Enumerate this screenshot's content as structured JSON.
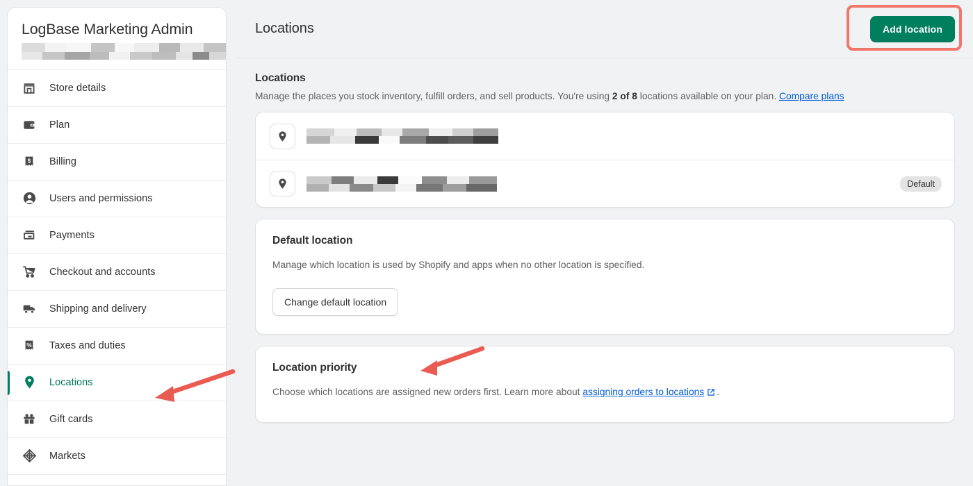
{
  "sidebar": {
    "store_title": "LogBase Marketing Admin",
    "store_subtitle_redacted": true,
    "items": [
      {
        "label": "Store details",
        "icon": "store-icon",
        "active": false
      },
      {
        "label": "Plan",
        "icon": "wallet-icon",
        "active": false
      },
      {
        "label": "Billing",
        "icon": "billing-receipt-icon",
        "active": false
      },
      {
        "label": "Users and permissions",
        "icon": "user-icon",
        "active": false
      },
      {
        "label": "Payments",
        "icon": "payments-card-icon",
        "active": false
      },
      {
        "label": "Checkout and accounts",
        "icon": "shopping-cart-icon",
        "active": false
      },
      {
        "label": "Shipping and delivery",
        "icon": "delivery-truck-icon",
        "active": false
      },
      {
        "label": "Taxes and duties",
        "icon": "percent-receipt-icon",
        "active": false
      },
      {
        "label": "Locations",
        "icon": "map-pin-icon",
        "active": true
      },
      {
        "label": "Gift cards",
        "icon": "gift-box-icon",
        "active": false
      },
      {
        "label": "Markets",
        "icon": "globe-icon",
        "active": false
      }
    ]
  },
  "header": {
    "title": "Locations",
    "add_location_label": "Add location"
  },
  "locations_section": {
    "title": "Locations",
    "description_part1": "Manage the places you stock inventory, fulfill orders, and sell products. You're using ",
    "description_count": "2 of 8",
    "description_part2": " locations available on your plan. ",
    "compare_plans_link": "Compare plans",
    "rows": [
      {
        "name_redacted": true,
        "badge": ""
      },
      {
        "name_redacted": true,
        "badge": "Default"
      }
    ]
  },
  "default_location_section": {
    "title": "Default location",
    "description": "Manage which location is used by Shopify and apps when no other location is specified.",
    "change_button_label": "Change default location"
  },
  "location_priority_section": {
    "title": "Location priority",
    "description_part1": "Choose which locations are assigned new orders first. Learn more about ",
    "link_label": "assigning orders to locations",
    "description_part2": "."
  },
  "colors": {
    "brand_green": "#007f5f",
    "annotation_red": "#f2776b",
    "link_blue": "#005bd3",
    "page_bg": "#f1f2f4",
    "text_primary": "#303030",
    "text_secondary": "#616161"
  }
}
